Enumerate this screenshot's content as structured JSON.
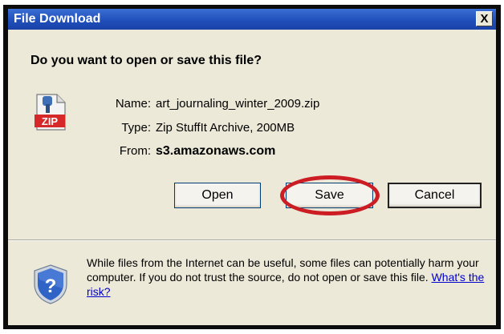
{
  "window": {
    "title": "File Download",
    "close_glyph": "X"
  },
  "dialog": {
    "question": "Do you want to open or save this file?",
    "file_icon": "zip-file-icon",
    "name_label": "Name:",
    "name_value": "art_journaling_winter_2009.zip",
    "type_label": "Type:",
    "type_value": "Zip StuffIt Archive, 200MB",
    "from_label": "From:",
    "from_value": "s3.amazonaws.com"
  },
  "buttons": {
    "open": "Open",
    "save": "Save",
    "cancel": "Cancel"
  },
  "annotation": {
    "highlight_color": "#cc1d24",
    "highlighted_button": "Save"
  },
  "warning": {
    "icon": "shield-question-icon",
    "text": "While files from the Internet can be useful, some files can potentially harm your computer. If you do not trust the source, do not open or save this file.",
    "link": "What's the risk?"
  },
  "colors": {
    "titlebar": "#1f4db8",
    "dialog_bg": "#ece9d8",
    "link": "#0000cc"
  }
}
